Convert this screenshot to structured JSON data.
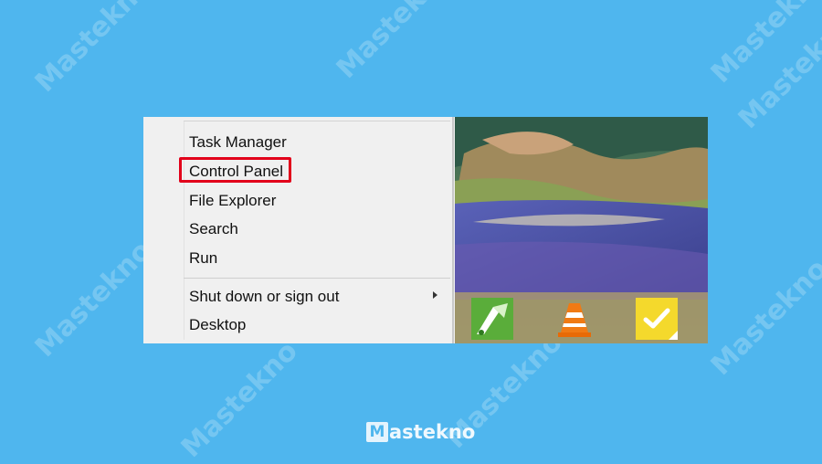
{
  "menu": {
    "items": [
      {
        "label": "Task Manager"
      },
      {
        "label": "Control Panel",
        "highlighted": true
      },
      {
        "label": "File Explorer"
      },
      {
        "label": "Search"
      },
      {
        "label": "Run"
      },
      {
        "label": "Shut down or sign out",
        "has_submenu": true
      },
      {
        "label": "Desktop"
      }
    ],
    "highlight_color": "#e2001a"
  },
  "taskbar_tiles": [
    {
      "icon": "coreldraw-icon",
      "color": "#5aad3a"
    },
    {
      "icon": "vlc-icon",
      "color": "#f07a14"
    },
    {
      "icon": "sticky-notes-icon",
      "color": "#f4d92c"
    }
  ],
  "watermark": {
    "text": "Mastekno"
  },
  "colors": {
    "background": "#4fb6ee",
    "menu_bg": "#f0f0f0"
  }
}
